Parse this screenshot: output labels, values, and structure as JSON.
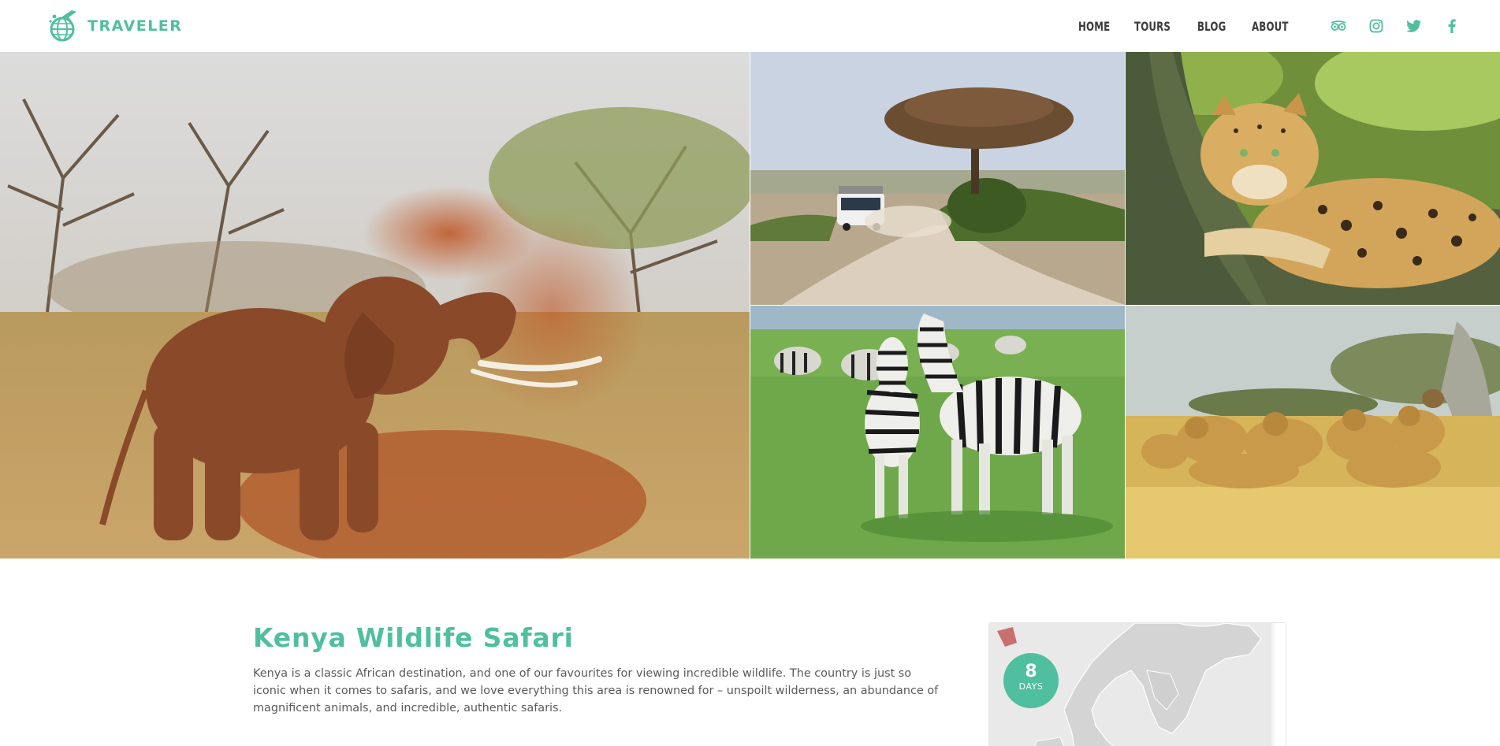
{
  "brand": {
    "name": "TRAVELER",
    "accent_color": "#4fbf9f"
  },
  "nav": {
    "items": [
      {
        "label": "HOME"
      },
      {
        "label": "TOURS"
      },
      {
        "label": "BLOG"
      },
      {
        "label": "ABOUT"
      }
    ]
  },
  "social": [
    {
      "icon": "tripadvisor-icon"
    },
    {
      "icon": "instagram-icon"
    },
    {
      "icon": "twitter-icon"
    },
    {
      "icon": "facebook-icon"
    }
  ],
  "gallery": [
    {
      "subject": "elephant-dust-bath",
      "icon": "photo"
    },
    {
      "subject": "safari-van-acacia-road",
      "icon": "photo"
    },
    {
      "subject": "leopard-in-tree",
      "icon": "photo"
    },
    {
      "subject": "zebras-on-grassland",
      "icon": "photo"
    },
    {
      "subject": "lion-pride-resting",
      "icon": "photo"
    }
  ],
  "tour": {
    "title": "Kenya Wildlife Safari",
    "description": "Kenya is a classic African destination, and one of our favourites for viewing incredible wildlife. The country is just so iconic when it comes to safaris, and we love everything this area is renowned for – unspoilt wilderness, an abundance of magnificent animals, and incredible, authentic safaris."
  },
  "duration": {
    "number": "8",
    "unit": "DAYS"
  }
}
